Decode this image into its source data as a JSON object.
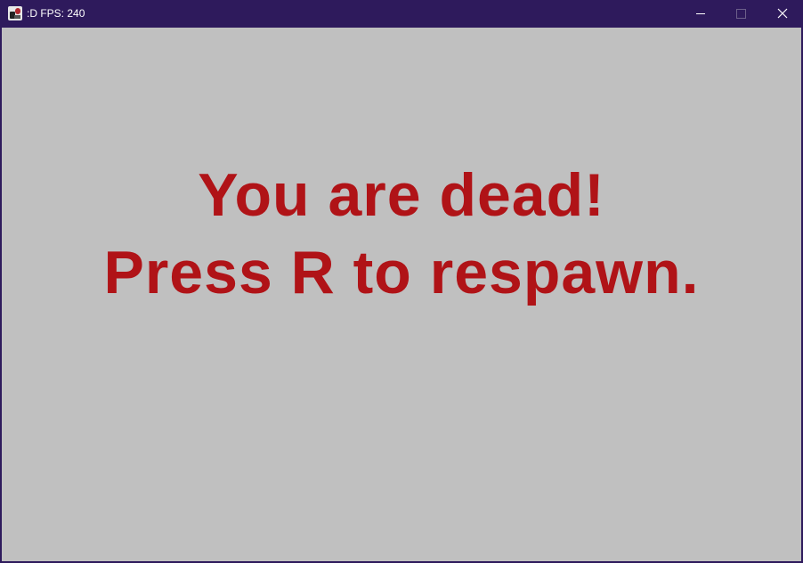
{
  "window": {
    "title": ":D FPS: 240",
    "icon": "game-app-icon"
  },
  "colors": {
    "titlebar": "#2e1a5c",
    "background": "#c0c0c0",
    "message": "#b01317"
  },
  "game": {
    "death_message_line1": "You are dead!",
    "death_message_line2": "Press R to respawn."
  }
}
